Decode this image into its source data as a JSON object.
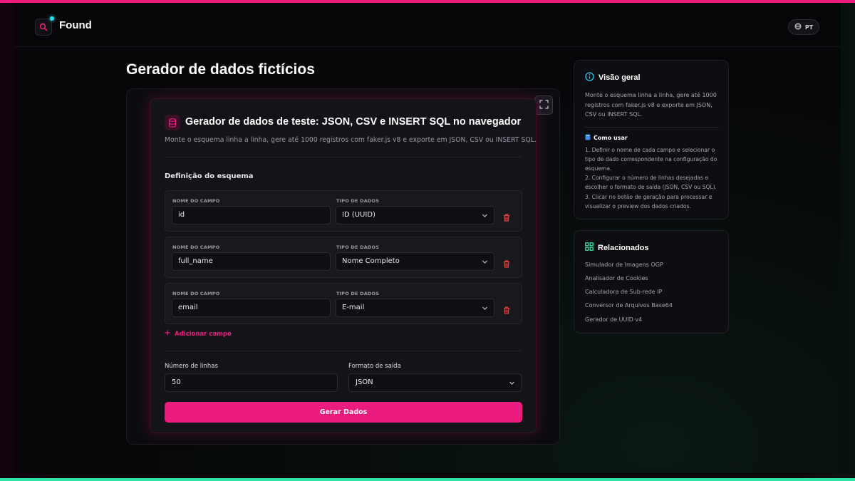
{
  "app": {
    "name": "Found",
    "language": "PT"
  },
  "page": {
    "title": "Gerador de dados fictícios"
  },
  "tool": {
    "title": "Gerador de dados de teste: JSON, CSV e INSERT SQL no navegador",
    "description": "Monte o esquema linha a linha, gere até 1000 registros com faker.js v8 e exporte em JSON, CSV ou INSERT SQL.",
    "schema_title": "Definição do esquema",
    "field_name_label": "NOME DO CAMPO",
    "data_type_label": "TIPO DE DADOS",
    "fields": [
      {
        "name": "id",
        "type": "ID (UUID)"
      },
      {
        "name": "full_name",
        "type": "Nome Completo"
      },
      {
        "name": "email",
        "type": "E-mail"
      }
    ],
    "add_field_label": "Adicionar campo",
    "rows_label": "Número de linhas",
    "rows_value": "50",
    "format_label": "Formato de saída",
    "format_value": "JSON",
    "generate_label": "Gerar Dados"
  },
  "overview": {
    "title": "Visão geral",
    "text": "Monte o esquema linha a linha, gere até 1000 registros com faker.js v8 e exporte em JSON, CSV ou INSERT SQL.",
    "how_to_title": "Como usar",
    "steps": [
      "1. Definir o nome de cada campo e selecionar o tipo de dado correspondente na configuração do esquema.",
      "2. Configurar o número de linhas desejadas e escolher o formato de saída (JSON, CSV ou SQL).",
      "3. Clicar no botão de geração para processar e visualizar o preview dos dados criados."
    ]
  },
  "related": {
    "title": "Relacionados",
    "items": [
      "Simulador de Imagens OGP",
      "Analisador de Cookies",
      "Calculadora de Sub-rede IP",
      "Conversor de Arquivos Base64",
      "Gerador de UUID v4"
    ]
  },
  "colors": {
    "accent": "#ec1b7e",
    "teal": "#2ee3a7",
    "cyan": "#25e0e8"
  },
  "icons": {
    "logo": "search-icon",
    "language": "globe-icon",
    "expand": "fullscreen-icon",
    "tool": "database-icon",
    "delete": "trash-icon",
    "add": "plus-icon",
    "overview": "info-icon",
    "how_to": "book-icon",
    "related": "grid-icon"
  }
}
